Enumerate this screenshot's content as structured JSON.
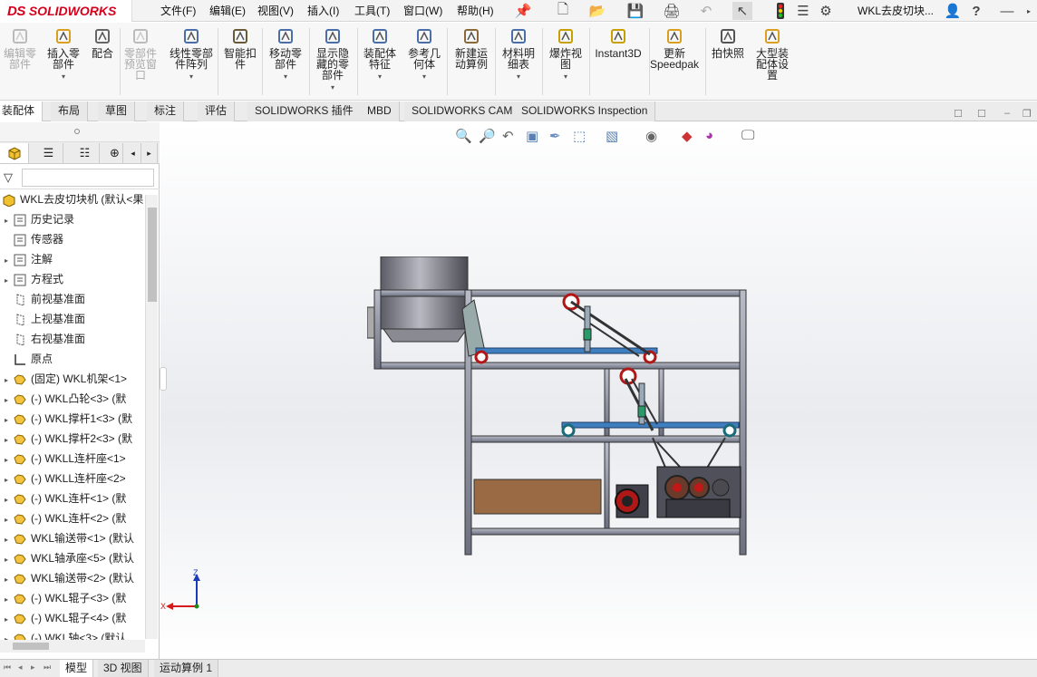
{
  "app": {
    "brand_ds": "DS",
    "brand_name": "SOLIDWORKS",
    "doc_title": "WKL去皮切块..."
  },
  "menu": [
    "文件(F)",
    "编辑(E)",
    "视图(V)",
    "插入(I)",
    "工具(T)",
    "窗口(W)",
    "帮助(H)"
  ],
  "commands": [
    {
      "label": "编辑零\n部件",
      "disabled": true
    },
    {
      "label": "插入零\n部件",
      "disabled": false
    },
    {
      "label": "配合",
      "disabled": false
    },
    {
      "label": "零部件\n预览窗\n口",
      "disabled": true
    },
    {
      "label": "线性零部\n件阵列",
      "disabled": false
    },
    {
      "label": "智能扣\n件",
      "disabled": false
    },
    {
      "label": "移动零\n部件",
      "disabled": false
    },
    {
      "label": "显示隐\n藏的零\n部件",
      "disabled": false
    },
    {
      "label": "装配体\n特征",
      "disabled": false
    },
    {
      "label": "参考几\n何体",
      "disabled": false
    },
    {
      "label": "新建运\n动算例",
      "disabled": false
    },
    {
      "label": "材料明\n细表",
      "disabled": false
    },
    {
      "label": "爆炸视\n图",
      "disabled": false
    },
    {
      "label": "Instant3D",
      "disabled": false
    },
    {
      "label": "更新\nSpeedpak",
      "disabled": false
    },
    {
      "label": "拍快照",
      "disabled": false
    },
    {
      "label": "大型装\n配体设\n置",
      "disabled": false
    }
  ],
  "tabs": [
    "装配体",
    "布局",
    "草图",
    "标注",
    "评估",
    "SOLIDWORKS 插件",
    "MBD",
    "SOLIDWORKS CAM",
    "SOLIDWORKS Inspection"
  ],
  "tree": {
    "root": "WKL去皮切块机 (默认<果",
    "items": [
      {
        "label": "历史记录",
        "exp": true,
        "icon": "history-icon"
      },
      {
        "label": "传感器",
        "exp": false,
        "icon": "sensor-icon"
      },
      {
        "label": "注解",
        "exp": true,
        "icon": "annotation-icon"
      },
      {
        "label": "方程式",
        "exp": true,
        "icon": "equation-icon"
      },
      {
        "label": "前视基准面",
        "exp": false,
        "icon": "plane-icon"
      },
      {
        "label": "上视基准面",
        "exp": false,
        "icon": "plane-icon"
      },
      {
        "label": "右视基准面",
        "exp": false,
        "icon": "plane-icon"
      },
      {
        "label": "原点",
        "exp": false,
        "icon": "origin-icon"
      },
      {
        "label": "(固定) WKL机架<1>",
        "exp": true,
        "icon": "part-icon"
      },
      {
        "label": "(-) WKL凸轮<3> (默",
        "exp": true,
        "icon": "part-icon"
      },
      {
        "label": "(-) WKL撑杆1<3> (默",
        "exp": true,
        "icon": "part-icon"
      },
      {
        "label": "(-) WKL撑杆2<3> (默",
        "exp": true,
        "icon": "part-icon"
      },
      {
        "label": "(-) WKLL连杆座<1>",
        "exp": true,
        "icon": "part-icon"
      },
      {
        "label": "(-) WKLL连杆座<2>",
        "exp": true,
        "icon": "part-icon"
      },
      {
        "label": "(-) WKL连杆<1> (默",
        "exp": true,
        "icon": "part-icon"
      },
      {
        "label": "(-) WKL连杆<2> (默",
        "exp": true,
        "icon": "part-icon"
      },
      {
        "label": "WKL输送带<1> (默认",
        "exp": true,
        "icon": "part-icon"
      },
      {
        "label": "WKL轴承座<5> (默认",
        "exp": true,
        "icon": "part-icon"
      },
      {
        "label": "WKL输送带<2> (默认",
        "exp": true,
        "icon": "part-icon"
      },
      {
        "label": "(-) WKL辊子<3> (默",
        "exp": true,
        "icon": "part-icon"
      },
      {
        "label": "(-) WKL辊子<4> (默",
        "exp": true,
        "icon": "part-icon"
      },
      {
        "label": "(-) WKL轴<3> (默认",
        "exp": true,
        "icon": "part-icon"
      }
    ]
  },
  "bottom_tabs": [
    "模型",
    "3D 视图",
    "运动算例 1"
  ],
  "triad": {
    "x": "X",
    "z": "Z"
  }
}
